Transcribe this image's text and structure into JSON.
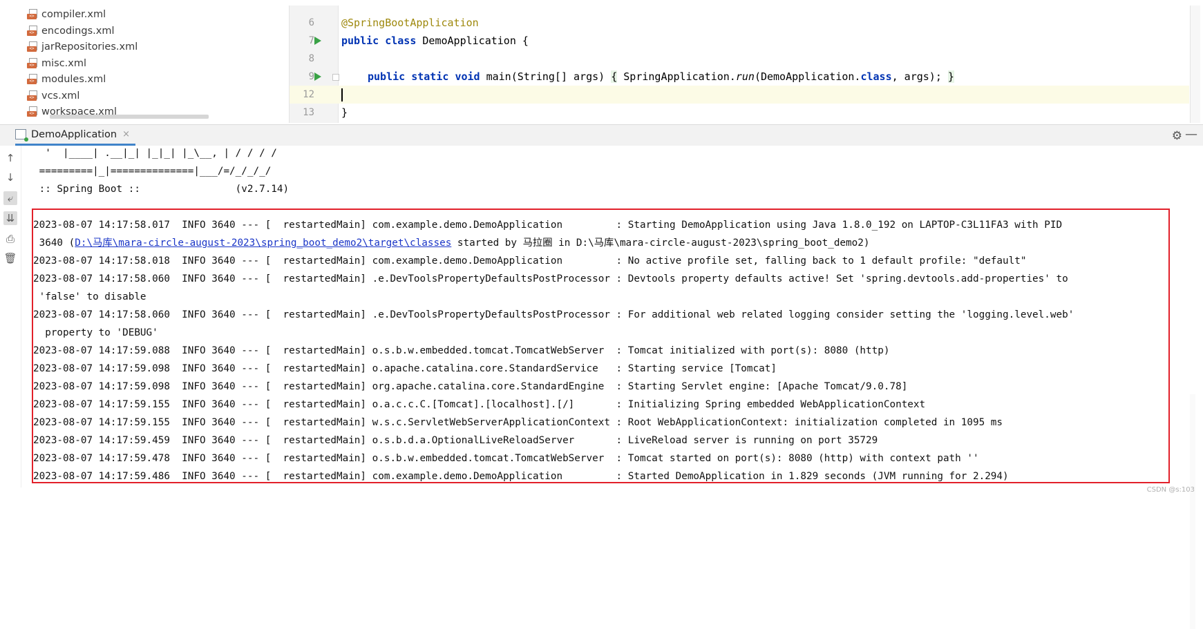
{
  "project_tree": {
    "items": [
      "compiler.xml",
      "encodings.xml",
      "jarRepositories.xml",
      "misc.xml",
      "modules.xml",
      "vcs.xml",
      "workspace.xml"
    ]
  },
  "editor": {
    "lines": [
      {
        "num": "6",
        "text": "@SpringBootApplication"
      },
      {
        "num": "7",
        "kw1": "public",
        "kw2": "class",
        "rest": " DemoApplication {"
      },
      {
        "num": "8"
      },
      {
        "num": "9",
        "kw1": "public",
        "kw2": "static",
        "kw3": "void",
        "p1": " main(String[] args) ",
        "p2": "{",
        "p3": " SpringApplication.",
        "run": "run",
        "p4": "(DemoApplication.",
        "kw4": "class",
        "p5": ", args); ",
        "p6": "}"
      },
      {
        "num": "12"
      },
      {
        "num": "13",
        "text": "}"
      }
    ]
  },
  "run_panel": {
    "tab_label": "DemoApplication",
    "close_glyph": "×"
  },
  "console": {
    "banner": [
      "  '  |____| .__|_| |_|_| |_\\__, | / / / /",
      " =========|_|==============|___/=/_/_/_/",
      " :: Spring Boot ::                (v2.7.14)"
    ],
    "log": [
      "2023-08-07 14:17:58.017  INFO 3640 --- [  restartedMain] com.example.demo.DemoApplication         : Starting DemoApplication using Java 1.8.0_192 on LAPTOP-C3L11FA3 with PID",
      " 3640 (",
      "D:\\马库\\mara-circle-august-2023\\spring_boot_demo2\\target\\classes",
      " started by 马拉圈 in D:\\马库\\mara-circle-august-2023\\spring_boot_demo2)",
      "2023-08-07 14:17:58.018  INFO 3640 --- [  restartedMain] com.example.demo.DemoApplication         : No active profile set, falling back to 1 default profile: \"default\"",
      "2023-08-07 14:17:58.060  INFO 3640 --- [  restartedMain] .e.DevToolsPropertyDefaultsPostProcessor : Devtools property defaults active! Set 'spring.devtools.add-properties' to",
      " 'false' to disable",
      "2023-08-07 14:17:58.060  INFO 3640 --- [  restartedMain] .e.DevToolsPropertyDefaultsPostProcessor : For additional web related logging consider setting the 'logging.level.web'",
      "  property to 'DEBUG'",
      "2023-08-07 14:17:59.088  INFO 3640 --- [  restartedMain] o.s.b.w.embedded.tomcat.TomcatWebServer  : Tomcat initialized with port(s): 8080 (http)",
      "2023-08-07 14:17:59.098  INFO 3640 --- [  restartedMain] o.apache.catalina.core.StandardService   : Starting service [Tomcat]",
      "2023-08-07 14:17:59.098  INFO 3640 --- [  restartedMain] org.apache.catalina.core.StandardEngine  : Starting Servlet engine: [Apache Tomcat/9.0.78]",
      "2023-08-07 14:17:59.155  INFO 3640 --- [  restartedMain] o.a.c.c.C.[Tomcat].[localhost].[/]       : Initializing Spring embedded WebApplicationContext",
      "2023-08-07 14:17:59.155  INFO 3640 --- [  restartedMain] w.s.c.ServletWebServerApplicationContext : Root WebApplicationContext: initialization completed in 1095 ms",
      "2023-08-07 14:17:59.459  INFO 3640 --- [  restartedMain] o.s.b.d.a.OptionalLiveReloadServer       : LiveReload server is running on port 35729",
      "2023-08-07 14:17:59.478  INFO 3640 --- [  restartedMain] o.s.b.w.embedded.tomcat.TomcatWebServer  : Tomcat started on port(s): 8080 (http) with context path ''",
      "2023-08-07 14:17:59.486  INFO 3640 --- [  restartedMain] com.example.demo.DemoApplication         : Started DemoApplication in 1.829 seconds (JVM running for 2.294)"
    ]
  },
  "toolstrip_icons": [
    "arrow-up-icon",
    "arrow-down-icon",
    "soft-wrap-icon",
    "scroll-to-end-icon",
    "print-icon",
    "trash-icon"
  ],
  "watermark": "CSDN @s:103",
  "colors": {
    "highlight_box": "#e2202a",
    "link": "#1a35c7",
    "keyword": "#0033b3",
    "annotation": "#9e880d"
  }
}
